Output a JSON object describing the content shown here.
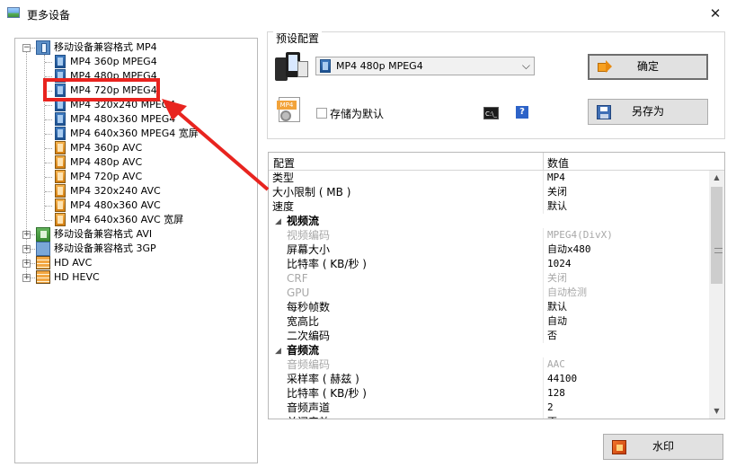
{
  "window": {
    "title": "更多设备",
    "close_glyph": "✕"
  },
  "tree": {
    "nodes": [
      {
        "label": "移动设备兼容格式 MP4",
        "level": 0,
        "expander": "−",
        "icon": "folder-video-icon"
      },
      {
        "label": "MP4 360p MPEG4",
        "level": 1,
        "icon": "mpeg4-icon"
      },
      {
        "label": "MP4 480p MPEG4",
        "level": 1,
        "icon": "mpeg4-icon"
      },
      {
        "label": "MP4 720p MPEG4",
        "level": 1,
        "icon": "mpeg4-icon",
        "highlighted": true
      },
      {
        "label": "MP4 320x240 MPEG4",
        "level": 1,
        "icon": "mpeg4-icon"
      },
      {
        "label": "MP4 480x360 MPEG4",
        "level": 1,
        "icon": "mpeg4-icon"
      },
      {
        "label": "MP4 640x360 MPEG4 宽屏",
        "level": 1,
        "icon": "mpeg4-icon"
      },
      {
        "label": "MP4 360p AVC",
        "level": 1,
        "icon": "avc-icon"
      },
      {
        "label": "MP4 480p AVC",
        "level": 1,
        "icon": "avc-icon"
      },
      {
        "label": "MP4 720p AVC",
        "level": 1,
        "icon": "avc-icon"
      },
      {
        "label": "MP4 320x240 AVC",
        "level": 1,
        "icon": "avc-icon"
      },
      {
        "label": "MP4 480x360 AVC",
        "level": 1,
        "icon": "avc-icon"
      },
      {
        "label": "MP4 640x360 AVC 宽屏",
        "level": 1,
        "icon": "avc-icon"
      },
      {
        "label": "移动设备兼容格式 AVI",
        "level": 0,
        "expander": "+",
        "icon": "folder-avi-icon"
      },
      {
        "label": "移动设备兼容格式 3GP",
        "level": 0,
        "expander": "+",
        "icon": "folder-3gp-icon"
      },
      {
        "label": "HD AVC",
        "level": 0,
        "expander": "+",
        "icon": "film-icon"
      },
      {
        "label": "HD HEVC",
        "level": 0,
        "expander": "+",
        "icon": "film-icon"
      }
    ]
  },
  "preset": {
    "group_title": "预设配置",
    "selected": "MP4 480p MPEG4",
    "save_default_label": "存储为默认",
    "ok_label": "确定",
    "save_as_label": "另存为",
    "mp4_icon_text": "MP4",
    "cmd_icon_text": "C:\\_",
    "help_icon_text": "?"
  },
  "grid": {
    "header_key": "配置",
    "header_value": "数值",
    "rows": [
      {
        "key": "类型",
        "value": "MP4",
        "kind": "normal"
      },
      {
        "key": "大小限制 ( MB )",
        "value": "关闭",
        "kind": "normal"
      },
      {
        "key": "速度",
        "value": "默认",
        "kind": "normal"
      },
      {
        "key": "视频流",
        "value": "",
        "kind": "section"
      },
      {
        "key": "视频编码",
        "value": "MPEG4(DivX)",
        "kind": "disabled"
      },
      {
        "key": "屏幕大小",
        "value": "自动x480",
        "kind": "indent"
      },
      {
        "key": "比特率 ( KB/秒 )",
        "value": "1024",
        "kind": "indent"
      },
      {
        "key": "CRF",
        "value": "关闭",
        "kind": "disabled"
      },
      {
        "key": "GPU",
        "value": "自动检测",
        "kind": "disabled"
      },
      {
        "key": "每秒帧数",
        "value": "默认",
        "kind": "indent"
      },
      {
        "key": "宽高比",
        "value": "自动",
        "kind": "indent"
      },
      {
        "key": "二次编码",
        "value": "否",
        "kind": "indent"
      },
      {
        "key": "音频流",
        "value": "",
        "kind": "section"
      },
      {
        "key": "音频编码",
        "value": "AAC",
        "kind": "disabled"
      },
      {
        "key": "采样率 ( 赫兹 )",
        "value": "44100",
        "kind": "indent"
      },
      {
        "key": "比特率 ( KB/秒 )",
        "value": "128",
        "kind": "indent"
      },
      {
        "key": "音频声道",
        "value": "2",
        "kind": "indent"
      },
      {
        "key": "关闭音效",
        "value": "否",
        "kind": "indent"
      }
    ]
  },
  "watermark_label": "水印",
  "colors": {
    "annotation": "#e8241f",
    "button_bg": "#e1e1e1"
  }
}
